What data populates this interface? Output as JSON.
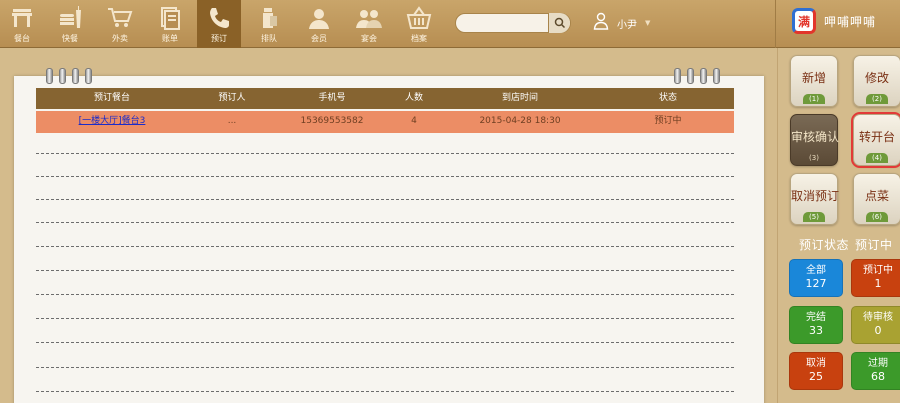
{
  "nav": {
    "items": [
      {
        "label": "餐台",
        "icon": "table-icon"
      },
      {
        "label": "快餐",
        "icon": "fastfood-icon"
      },
      {
        "label": "外卖",
        "icon": "cart-icon"
      },
      {
        "label": "账单",
        "icon": "bill-icon"
      },
      {
        "label": "预订",
        "icon": "phone-icon"
      },
      {
        "label": "排队",
        "icon": "queue-icon"
      },
      {
        "label": "会员",
        "icon": "member-icon"
      },
      {
        "label": "宴会",
        "icon": "banquet-icon"
      },
      {
        "label": "档案",
        "icon": "basket-icon"
      }
    ],
    "active": "预订"
  },
  "search": {
    "placeholder": "",
    "value": ""
  },
  "user": {
    "name": "小尹"
  },
  "brand": {
    "logo_char": "满",
    "name": "呷哺呷哺"
  },
  "table": {
    "headers": [
      "预订餐台",
      "预订人",
      "手机号",
      "人数",
      "到店时间",
      "状态"
    ],
    "rows": [
      {
        "table": "[一楼大厅]餐台3",
        "person": "...",
        "phone": "15369553582",
        "count": "4",
        "time": "2015-04-28 18:30",
        "status": "预订中"
      }
    ]
  },
  "actions": [
    {
      "label": "新增",
      "num": "(1)"
    },
    {
      "label": "修改",
      "num": "(2)"
    },
    {
      "label": "审核确认",
      "num": "(3)"
    },
    {
      "label": "转开台",
      "num": "(4)"
    },
    {
      "label": "取消预订",
      "num": "(5)"
    },
    {
      "label": "点菜",
      "num": "(6)"
    }
  ],
  "status_panel": {
    "title": "预订状态",
    "current": "预订中"
  },
  "stats": [
    {
      "label": "全部",
      "value": "127",
      "color": "#1a87d9"
    },
    {
      "label": "预订中",
      "value": "1",
      "color": "#c8410f"
    },
    {
      "label": "完结",
      "value": "33",
      "color": "#3c9a2a"
    },
    {
      "label": "待审核",
      "value": "0",
      "color": "#a9a232"
    },
    {
      "label": "取消",
      "value": "25",
      "color": "#c8410f"
    },
    {
      "label": "过期",
      "value": "68",
      "color": "#3c9a2a"
    }
  ]
}
